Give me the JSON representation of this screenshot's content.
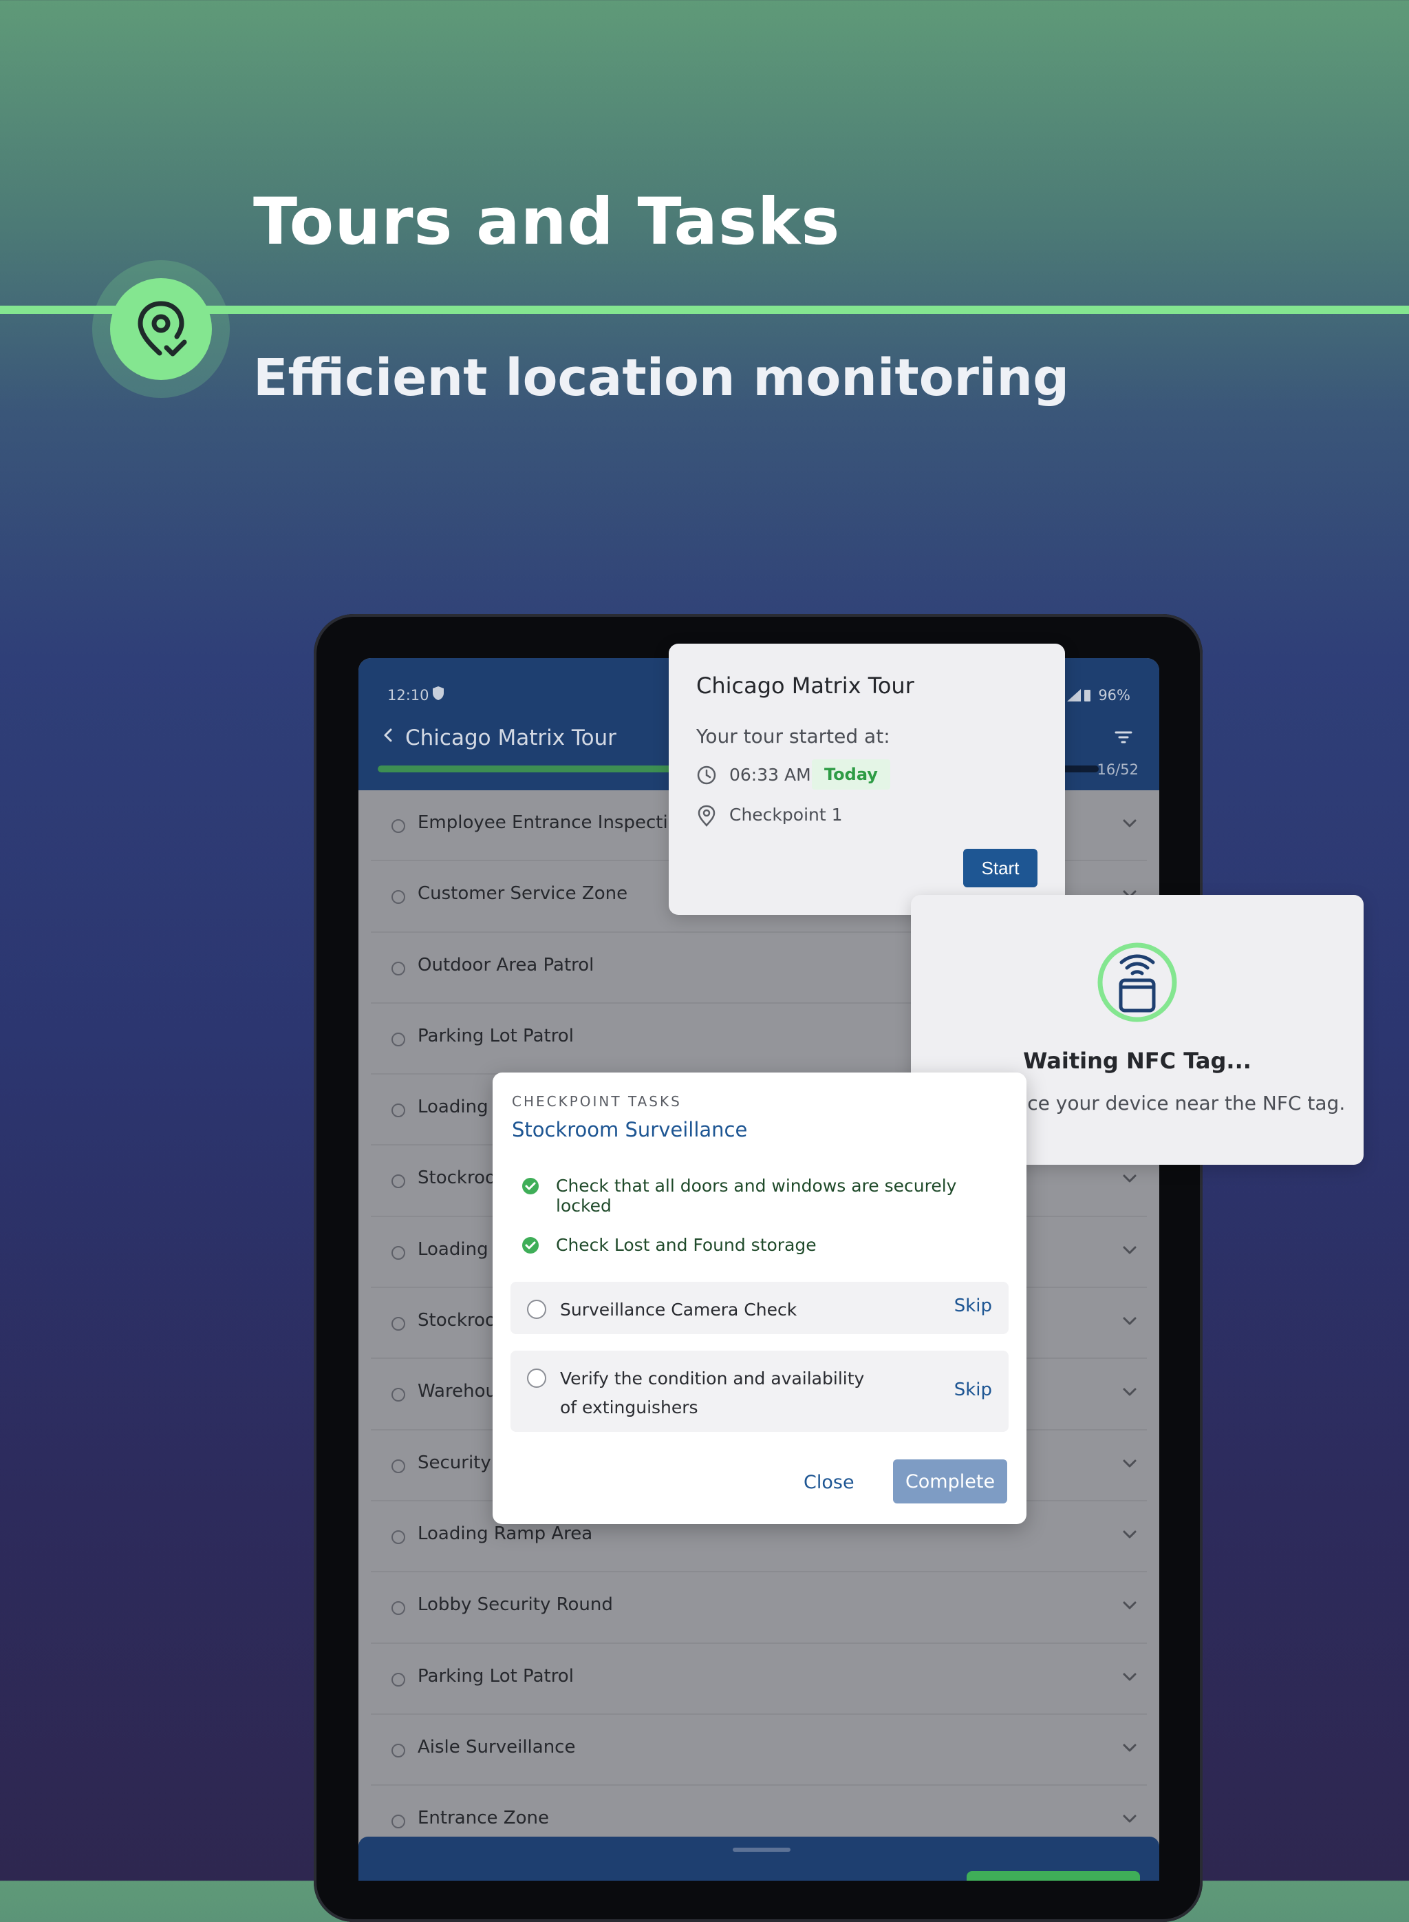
{
  "hero": {
    "title": "Tours and Tasks",
    "subtitle": "Efficient location monitoring",
    "badge_icon": "location-check-icon",
    "accent": "#84e690"
  },
  "status_bar": {
    "time": "12:10",
    "battery": "96%"
  },
  "app_bar": {
    "title": "Chicago Matrix Tour",
    "progress_count": "16/52",
    "progress_fraction": 0.5,
    "brand_color": "#1e3f70"
  },
  "checkpoints": [
    {
      "label": "Employee Entrance Inspection"
    },
    {
      "label": "Customer Service Zone"
    },
    {
      "label": "Outdoor Area Patrol"
    },
    {
      "label": "Parking Lot Patrol"
    },
    {
      "label": "Loading D"
    },
    {
      "label": "Stockroon"
    },
    {
      "label": "Loading D"
    },
    {
      "label": "Stockroon"
    },
    {
      "label": "Warehou"
    },
    {
      "label": "Security D"
    },
    {
      "label": "Loading Ramp Area"
    },
    {
      "label": "Lobby Security Round"
    },
    {
      "label": "Parking Lot Patrol"
    },
    {
      "label": "Aisle Surveillance"
    },
    {
      "label": "Entrance Zone"
    }
  ],
  "tour_card": {
    "title": "Chicago Matrix Tour",
    "started_label": "Your tour started at:",
    "time": "06:33 AM",
    "day_badge": "Today",
    "checkpoint": "Checkpoint 1",
    "start_button": "Start"
  },
  "nfc_card": {
    "title": "Waiting NFC Tag...",
    "message": "Please place your device near the NFC tag."
  },
  "tasks_card": {
    "kicker": "CHECKPOINT TASKS",
    "title": "Stockroom Surveillance",
    "done_tasks": [
      {
        "label": "Check that all doors and windows are securely locked"
      },
      {
        "label": "Check Lost and Found storage"
      }
    ],
    "open_tasks": [
      {
        "label": "Surveillance Camera Check",
        "action": "Skip"
      },
      {
        "label": "Verify the condition and availability of extinguishers",
        "action": "Skip"
      }
    ],
    "close_button": "Close",
    "complete_button": "Complete"
  }
}
